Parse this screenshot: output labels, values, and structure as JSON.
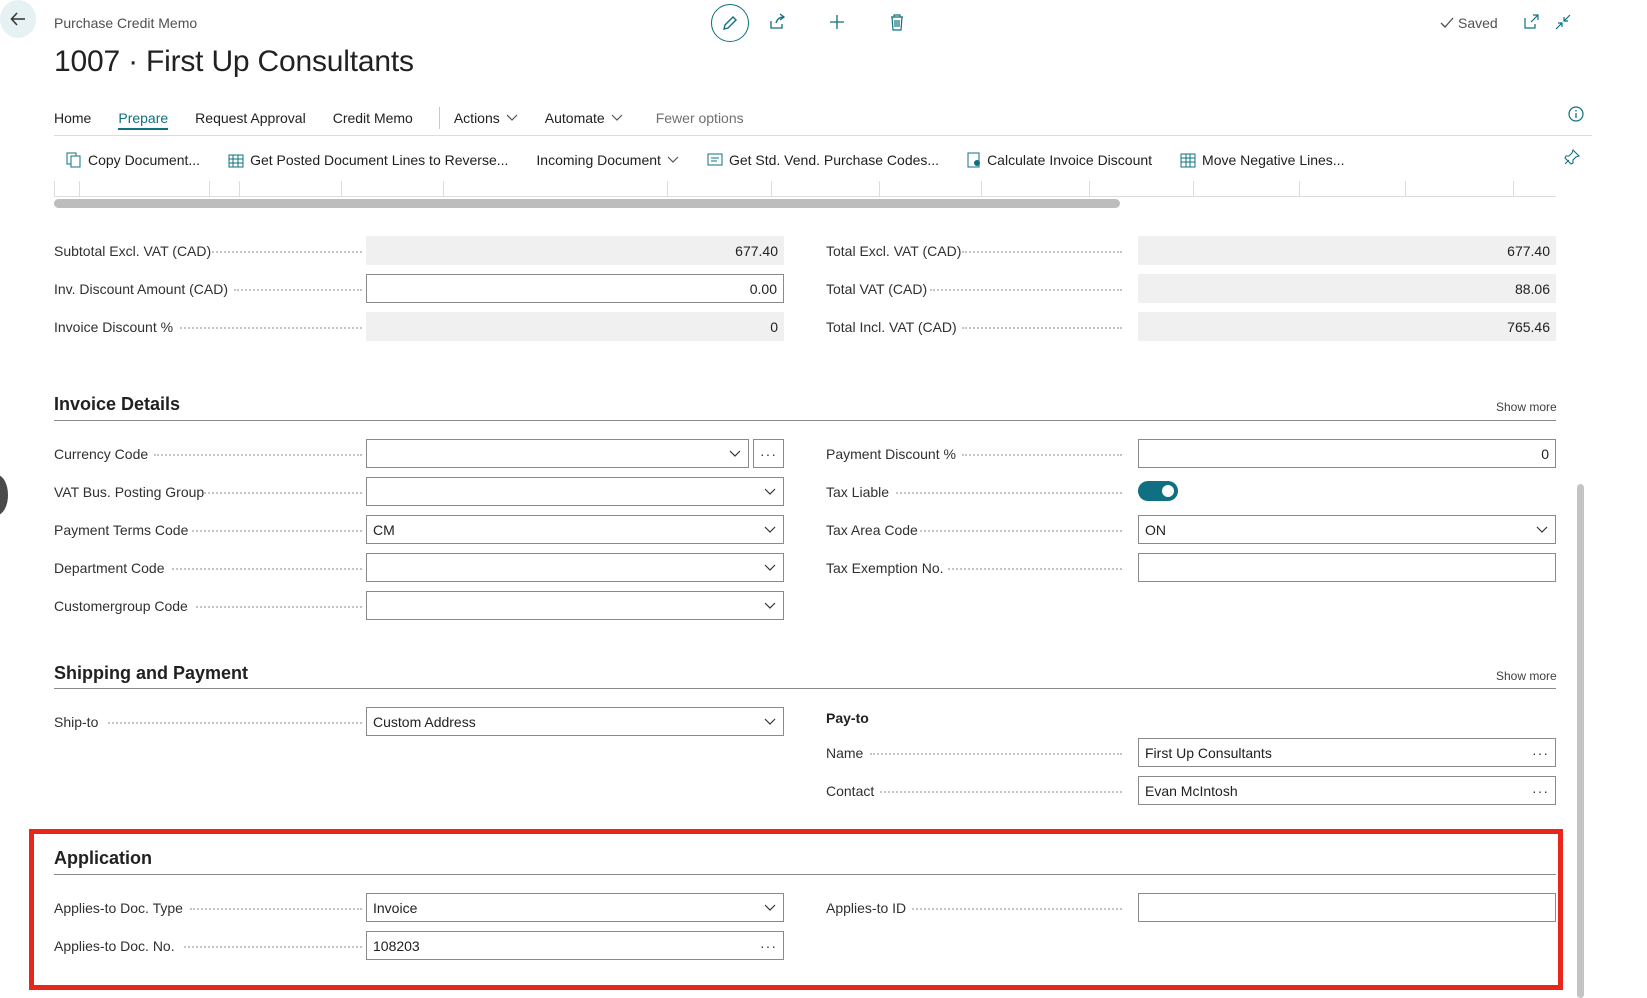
{
  "header": {
    "caption": "Purchase Credit Memo",
    "title": "1007 · First Up Consultants",
    "saved_label": "Saved"
  },
  "nav": {
    "tabs": [
      {
        "label": "Home"
      },
      {
        "label": "Prepare"
      },
      {
        "label": "Request Approval"
      },
      {
        "label": "Credit Memo"
      },
      {
        "label": "Actions"
      },
      {
        "label": "Automate"
      },
      {
        "label": "Fewer options"
      }
    ],
    "active": "Prepare"
  },
  "actions": [
    {
      "label": "Copy Document...",
      "icon": "copy-document-icon"
    },
    {
      "label": "Get Posted Document Lines to Reverse...",
      "icon": "reverse-lines-icon"
    },
    {
      "label": "Incoming Document",
      "icon": "chevron-down-icon"
    },
    {
      "label": "Get Std. Vend. Purchase Codes...",
      "icon": "purchase-codes-icon"
    },
    {
      "label": "Calculate Invoice Discount",
      "icon": "calculate-icon"
    },
    {
      "label": "Move Negative Lines...",
      "icon": "move-lines-icon"
    }
  ],
  "totals": {
    "left": [
      {
        "label": "Subtotal Excl. VAT (CAD)",
        "value": "677.40",
        "editable": false
      },
      {
        "label": "Inv. Discount Amount (CAD)",
        "value": "0.00",
        "editable": true
      },
      {
        "label": "Invoice Discount %",
        "value": "0",
        "editable": false
      }
    ],
    "right": [
      {
        "label": "Total Excl. VAT (CAD)",
        "value": "677.40"
      },
      {
        "label": "Total VAT (CAD)",
        "value": "88.06"
      },
      {
        "label": "Total Incl. VAT (CAD)",
        "value": "765.46"
      }
    ]
  },
  "invoice_details": {
    "title": "Invoice Details",
    "show_more": "Show more",
    "left": [
      {
        "label": "Currency Code",
        "value": ""
      },
      {
        "label": "VAT Bus. Posting Group",
        "value": ""
      },
      {
        "label": "Payment Terms Code",
        "value": "CM"
      },
      {
        "label": "Department Code",
        "value": ""
      },
      {
        "label": "Customergroup Code",
        "value": ""
      }
    ],
    "right": {
      "payment_discount": {
        "label": "Payment Discount %",
        "value": "0"
      },
      "tax_liable": {
        "label": "Tax Liable",
        "on": true
      },
      "tax_area": {
        "label": "Tax Area Code",
        "value": "ON"
      },
      "tax_exemption": {
        "label": "Tax Exemption No.",
        "value": ""
      }
    }
  },
  "shipping": {
    "title": "Shipping and Payment",
    "show_more": "Show more",
    "ship_to": {
      "label": "Ship-to",
      "value": "Custom Address"
    },
    "pay_to": {
      "heading": "Pay-to",
      "name": {
        "label": "Name",
        "value": "First Up Consultants"
      },
      "contact": {
        "label": "Contact",
        "value": "Evan McIntosh"
      }
    }
  },
  "application": {
    "title": "Application",
    "doc_type": {
      "label": "Applies-to Doc. Type",
      "value": "Invoice"
    },
    "doc_no": {
      "label": "Applies-to Doc. No.",
      "value": "108203"
    },
    "applies_id": {
      "label": "Applies-to ID",
      "value": ""
    }
  },
  "colors": {
    "accent": "#0e7080",
    "highlight": "#e8261c"
  }
}
